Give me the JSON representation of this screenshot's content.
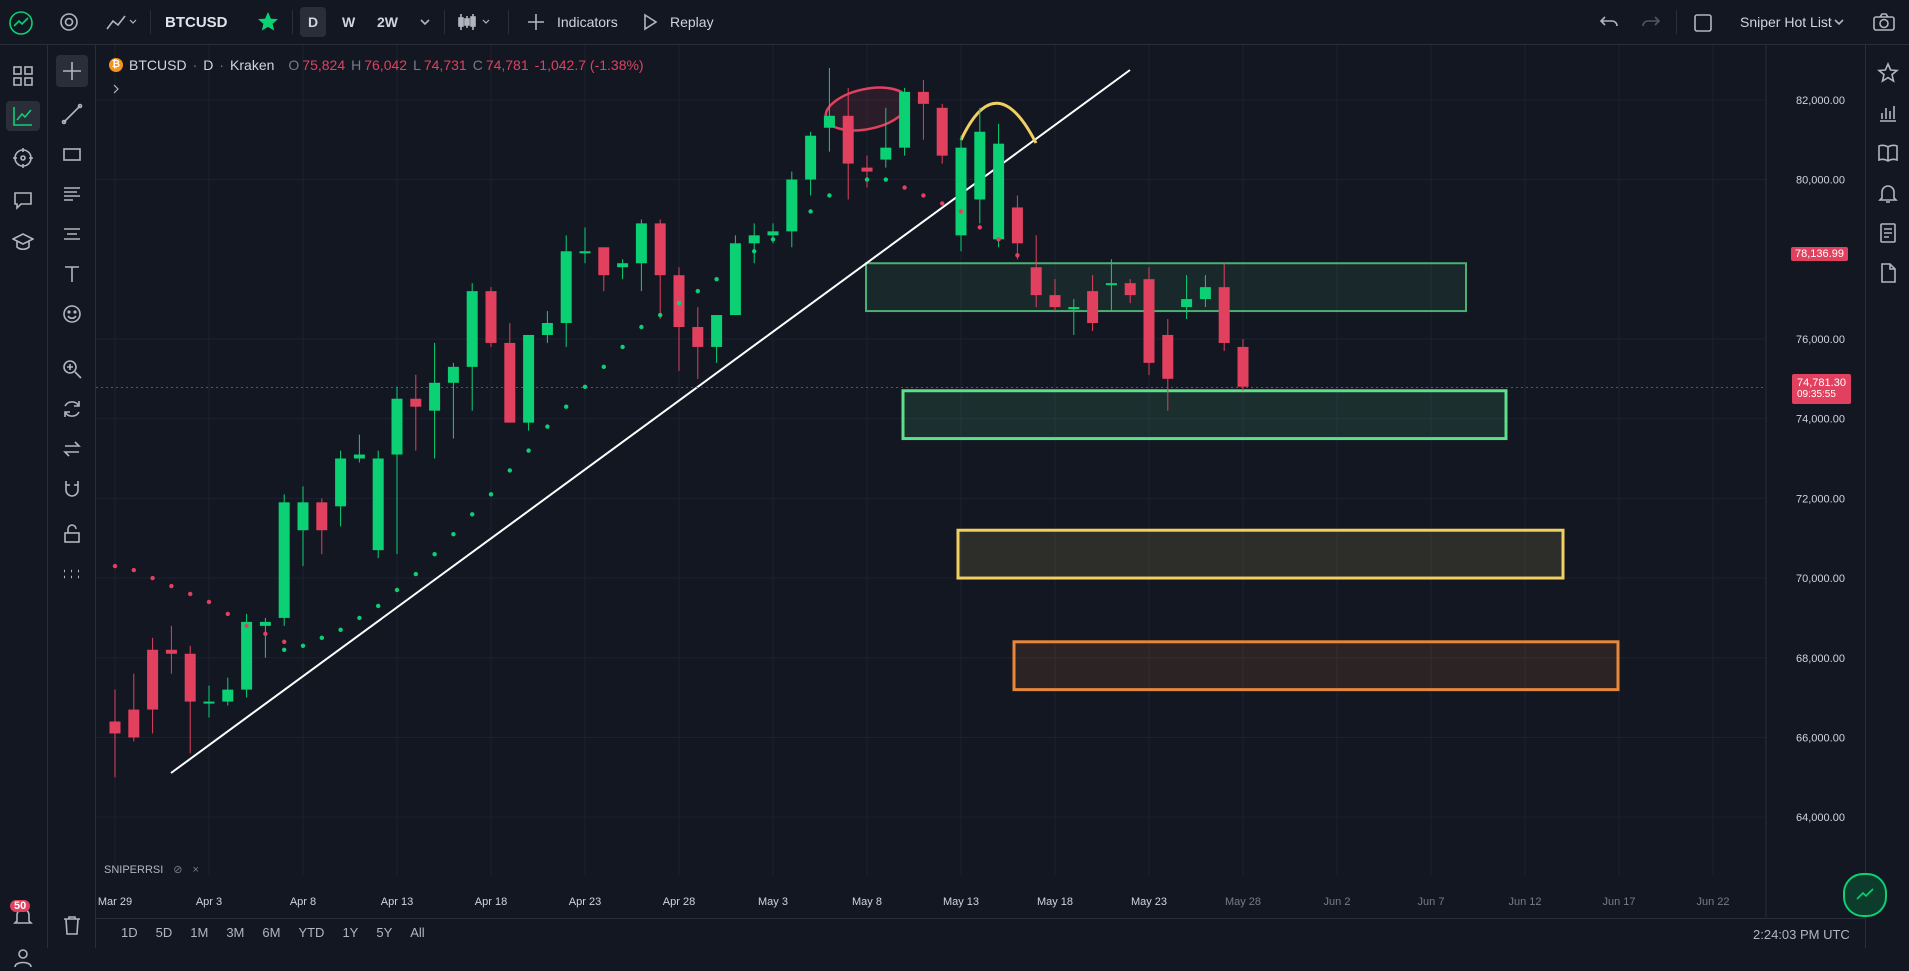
{
  "topbar": {
    "symbol": "BTCUSD",
    "intervals": [
      "D",
      "W",
      "2W"
    ],
    "active_interval": "D",
    "indicators_label": "Indicators",
    "replay_label": "Replay",
    "watchlist_label": "Sniper Hot List"
  },
  "header": {
    "symbol": "BTCUSD",
    "interval": "D",
    "exchange": "Kraken",
    "open_label": "O",
    "open": "75,824",
    "high_label": "H",
    "high": "76,042",
    "low_label": "L",
    "low": "74,731",
    "close_label": "C",
    "close": "74,781",
    "change": "-1,042.7 (-1.38%)"
  },
  "indicator_pane": {
    "name": "SNIPERRSI"
  },
  "price_tags": {
    "upper": "78,136.99",
    "current": "74,781.30",
    "countdown": "09:35:55"
  },
  "notifications": {
    "count": "50"
  },
  "bottombar": {
    "ranges": [
      "1D",
      "5D",
      "1M",
      "3M",
      "6M",
      "YTD",
      "1Y",
      "5Y",
      "All"
    ],
    "clock": "2:24:03 PM UTC"
  },
  "colors": {
    "bg": "#131722",
    "up": "#0bd174",
    "down": "#e2405f",
    "grid": "#1c2030"
  },
  "chart_data": {
    "type": "candlestick",
    "symbol": "BTCUSD",
    "exchange": "Kraken",
    "interval": "D",
    "ylim": [
      63000,
      83000
    ],
    "y_ticks": [
      "82,000.00",
      "80,000.00",
      "76,000.00",
      "74,000.00",
      "72,000.00",
      "70,000.00",
      "68,000.00",
      "66,000.00",
      "64,000.00"
    ],
    "y_tick_values": [
      82000,
      80000,
      76000,
      74000,
      72000,
      70000,
      68000,
      66000,
      64000
    ],
    "x_ticks": [
      "Mar 29",
      "Apr 3",
      "Apr 8",
      "Apr 13",
      "Apr 18",
      "Apr 23",
      "Apr 28",
      "May 3",
      "May 8",
      "May 13",
      "May 18",
      "May 23",
      "May 28",
      "Jun 2",
      "Jun 7",
      "Jun 12",
      "Jun 17",
      "Jun 22"
    ],
    "candles": [
      {
        "o": 66400,
        "h": 67200,
        "l": 65000,
        "c": 66100
      },
      {
        "o": 66700,
        "h": 67600,
        "l": 65900,
        "c": 66000
      },
      {
        "o": 68200,
        "h": 68500,
        "l": 66100,
        "c": 66700
      },
      {
        "o": 68200,
        "h": 68800,
        "l": 67600,
        "c": 68100
      },
      {
        "o": 68100,
        "h": 68300,
        "l": 65600,
        "c": 66900
      },
      {
        "o": 66900,
        "h": 67300,
        "l": 66500,
        "c": 66900
      },
      {
        "o": 66900,
        "h": 67500,
        "l": 66800,
        "c": 67200
      },
      {
        "o": 67200,
        "h": 69100,
        "l": 67000,
        "c": 68900
      },
      {
        "o": 68800,
        "h": 69000,
        "l": 68000,
        "c": 68900
      },
      {
        "o": 69000,
        "h": 72100,
        "l": 68800,
        "c": 71900
      },
      {
        "o": 71200,
        "h": 72300,
        "l": 70300,
        "c": 71900
      },
      {
        "o": 71900,
        "h": 72000,
        "l": 70600,
        "c": 71200
      },
      {
        "o": 71800,
        "h": 73200,
        "l": 71300,
        "c": 73000
      },
      {
        "o": 73000,
        "h": 73600,
        "l": 72900,
        "c": 73100
      },
      {
        "o": 70700,
        "h": 73200,
        "l": 70500,
        "c": 73000
      },
      {
        "o": 73100,
        "h": 74800,
        "l": 70600,
        "c": 74500
      },
      {
        "o": 74500,
        "h": 75100,
        "l": 73200,
        "c": 74300
      },
      {
        "o": 74200,
        "h": 75900,
        "l": 73000,
        "c": 74900
      },
      {
        "o": 74900,
        "h": 75400,
        "l": 73500,
        "c": 75300
      },
      {
        "o": 75300,
        "h": 77400,
        "l": 74200,
        "c": 77200
      },
      {
        "o": 77200,
        "h": 77300,
        "l": 75800,
        "c": 75900
      },
      {
        "o": 75900,
        "h": 76400,
        "l": 73900,
        "c": 73900
      },
      {
        "o": 73900,
        "h": 76100,
        "l": 73700,
        "c": 76100
      },
      {
        "o": 76100,
        "h": 76700,
        "l": 75900,
        "c": 76400
      },
      {
        "o": 76400,
        "h": 78600,
        "l": 75800,
        "c": 78200
      },
      {
        "o": 78200,
        "h": 78800,
        "l": 77900,
        "c": 78200
      },
      {
        "o": 78300,
        "h": 78300,
        "l": 77200,
        "c": 77600
      },
      {
        "o": 77800,
        "h": 78000,
        "l": 77500,
        "c": 77900
      },
      {
        "o": 77900,
        "h": 79000,
        "l": 77200,
        "c": 78900
      },
      {
        "o": 78900,
        "h": 79000,
        "l": 76500,
        "c": 77600
      },
      {
        "o": 77600,
        "h": 77800,
        "l": 75200,
        "c": 76300
      },
      {
        "o": 76300,
        "h": 76800,
        "l": 75000,
        "c": 75800
      },
      {
        "o": 75800,
        "h": 76600,
        "l": 75400,
        "c": 76600
      },
      {
        "o": 76600,
        "h": 78600,
        "l": 76600,
        "c": 78400
      },
      {
        "o": 78400,
        "h": 78900,
        "l": 77900,
        "c": 78600
      },
      {
        "o": 78600,
        "h": 78900,
        "l": 78400,
        "c": 78700
      },
      {
        "o": 78700,
        "h": 80200,
        "l": 78300,
        "c": 80000
      },
      {
        "o": 80000,
        "h": 81200,
        "l": 79600,
        "c": 81100
      },
      {
        "o": 81300,
        "h": 82800,
        "l": 80700,
        "c": 81600
      },
      {
        "o": 81600,
        "h": 82300,
        "l": 79500,
        "c": 80400
      },
      {
        "o": 80300,
        "h": 80600,
        "l": 79800,
        "c": 80200
      },
      {
        "o": 80500,
        "h": 81800,
        "l": 80300,
        "c": 80800
      },
      {
        "o": 80800,
        "h": 82300,
        "l": 80600,
        "c": 82200
      },
      {
        "o": 82200,
        "h": 82500,
        "l": 81000,
        "c": 81900
      },
      {
        "o": 81800,
        "h": 81900,
        "l": 80400,
        "c": 80600
      },
      {
        "o": 78600,
        "h": 81100,
        "l": 78200,
        "c": 80800
      },
      {
        "o": 79500,
        "h": 81800,
        "l": 78900,
        "c": 81200
      },
      {
        "o": 78500,
        "h": 81400,
        "l": 78300,
        "c": 80900
      },
      {
        "o": 79300,
        "h": 79600,
        "l": 78000,
        "c": 78400
      },
      {
        "o": 77800,
        "h": 78600,
        "l": 76800,
        "c": 77100
      },
      {
        "o": 77100,
        "h": 77500,
        "l": 76700,
        "c": 76800
      },
      {
        "o": 76800,
        "h": 77000,
        "l": 76100,
        "c": 76800
      },
      {
        "o": 77200,
        "h": 77600,
        "l": 76200,
        "c": 76400
      },
      {
        "o": 77400,
        "h": 78000,
        "l": 76700,
        "c": 77400
      },
      {
        "o": 77400,
        "h": 77500,
        "l": 76900,
        "c": 77100
      },
      {
        "o": 77500,
        "h": 77800,
        "l": 75100,
        "c": 75400
      },
      {
        "o": 76100,
        "h": 76500,
        "l": 74200,
        "c": 75000
      },
      {
        "o": 76800,
        "h": 77600,
        "l": 76500,
        "c": 77000
      },
      {
        "o": 77000,
        "h": 77600,
        "l": 76800,
        "c": 77300
      },
      {
        "o": 77300,
        "h": 77900,
        "l": 75700,
        "c": 75900
      },
      {
        "o": 75800,
        "h": 76000,
        "l": 74700,
        "c": 74800
      }
    ],
    "sar_below": [
      68200,
      68300,
      68500,
      68700,
      69000,
      69300,
      69700,
      70100,
      70600,
      71100,
      71600,
      72100,
      72700,
      73200,
      73800,
      74300,
      74800,
      75300,
      75800,
      76300,
      76600,
      76900,
      77200,
      77500,
      77800,
      78200,
      78500,
      78900,
      79200,
      79600
    ],
    "sar_above": [
      80000,
      80000,
      79800,
      79600,
      79400,
      79200,
      78800,
      78500,
      78100
    ],
    "sar_left": [
      70300,
      70200,
      70000,
      69800,
      69600,
      69400,
      69100,
      68800,
      68600,
      68400
    ],
    "zones": [
      {
        "from": 76700,
        "to": 77900,
        "color": "#4caf73"
      },
      {
        "from": 73500,
        "to": 74700,
        "color": "#5ee08a"
      },
      {
        "from": 70000,
        "to": 71200,
        "color": "#f0d060"
      },
      {
        "from": 67200,
        "to": 68400,
        "color": "#e8873a"
      }
    ],
    "last_price": 74781.3
  }
}
